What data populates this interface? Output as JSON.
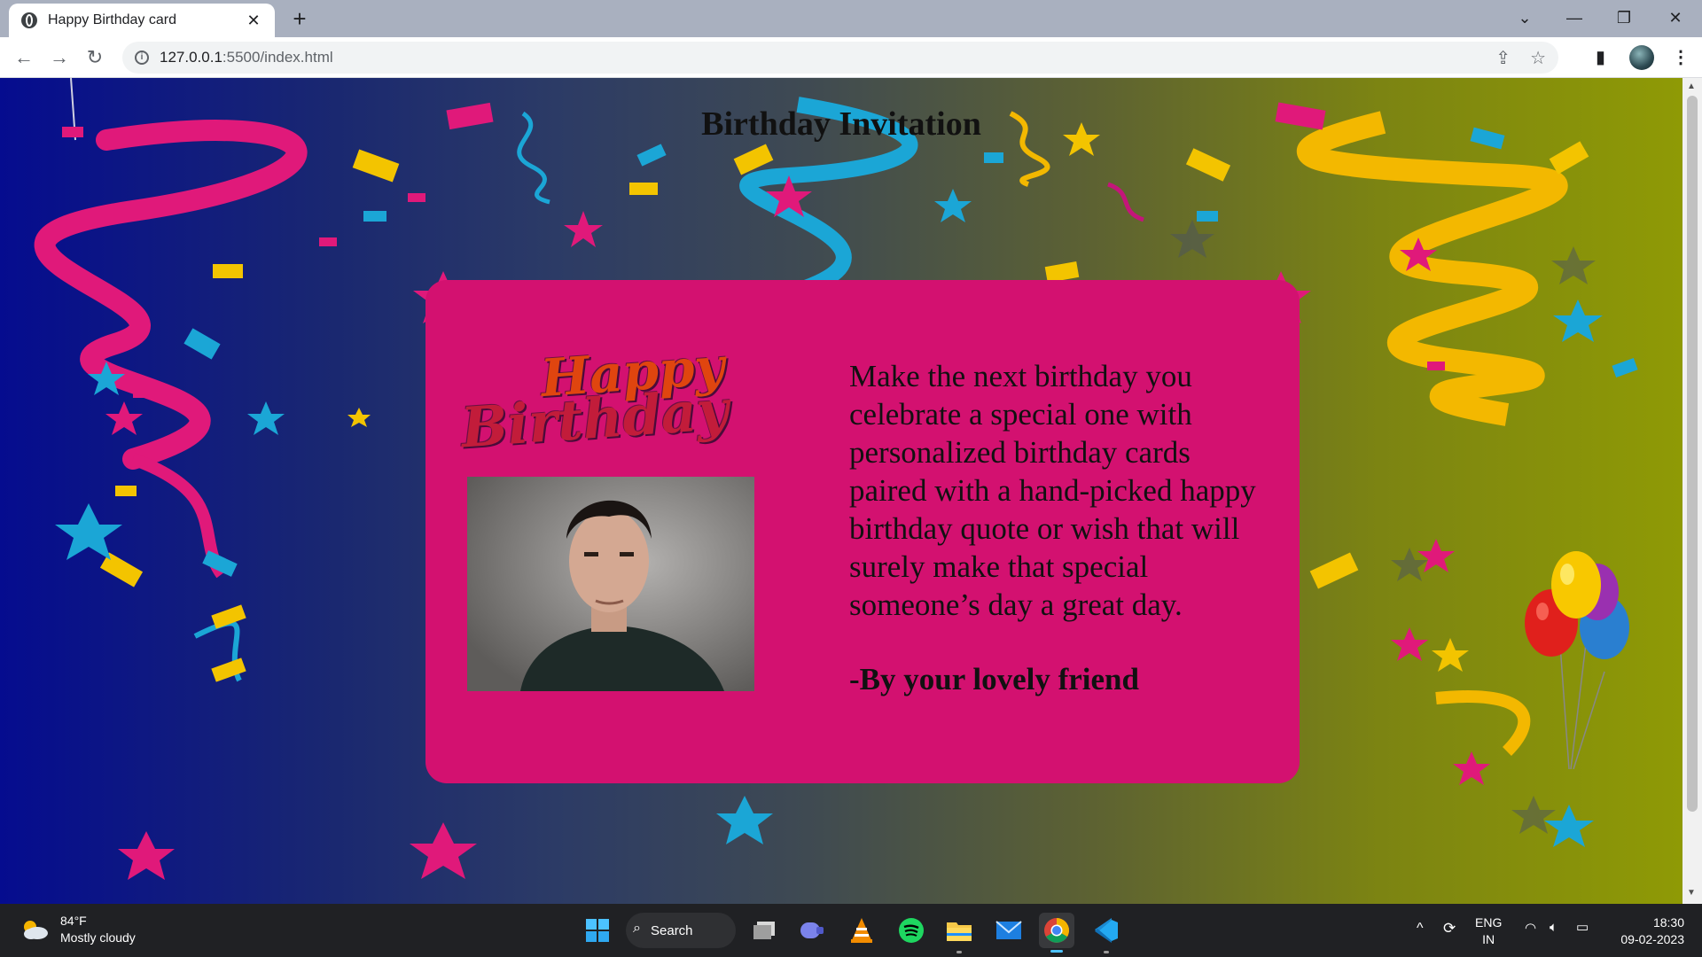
{
  "browser": {
    "tab_title": "Happy Birthday card",
    "tab_close": "✕",
    "new_tab": "+",
    "url_host": "127.0.0.1",
    "url_rest": ":5500/index.html",
    "window_controls": {
      "tabsearch": "⌄",
      "minimize": "—",
      "restore": "❐",
      "close": "✕"
    }
  },
  "page": {
    "heading": "Birthday Invitation",
    "greeting_line1": "Happy",
    "greeting_line2": "Birthday",
    "message": "Make the next birthday you celebrate a special one with personalized birthday cards paired with a hand-picked happy birthday quote or wish that will surely make that special someone’s day a great day.",
    "signature": "-By your lovely friend"
  },
  "colors": {
    "card": "#d31170",
    "gradient_start": "#050c8f",
    "gradient_end": "#8f9a05"
  },
  "taskbar": {
    "weather_temp": "84°F",
    "weather_desc": "Mostly cloudy",
    "search_label": "Search",
    "language": "ENG",
    "region": "IN",
    "time": "18:30",
    "date": "09-02-2023",
    "apps": [
      "windows-start-icon",
      "task-view-icon",
      "teams-icon",
      "vlc-icon",
      "spotify-icon",
      "file-explorer-icon",
      "mail-icon",
      "chrome-icon",
      "vscode-icon"
    ]
  }
}
